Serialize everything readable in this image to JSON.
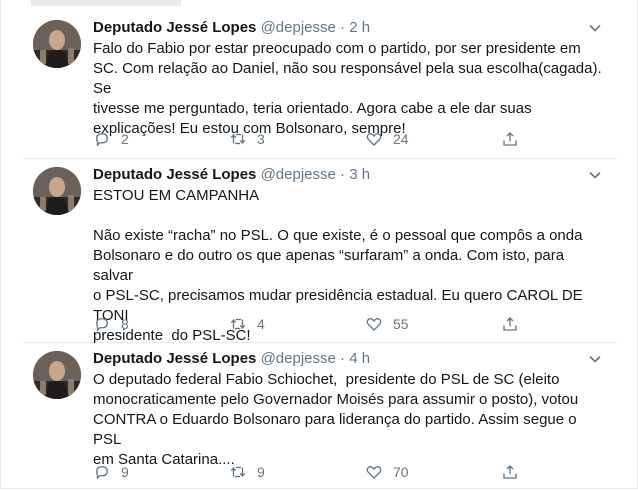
{
  "tweets": [
    {
      "name": "Deputado Jessé Lopes",
      "handle": "@depjesse",
      "separator": "·",
      "time": "2 h",
      "text": "Falo do Fabio por estar preocupado com o partido, por ser presidente em\nSC. Com relação ao Daniel, não sou responsável pela sua escolha(cagada). Se\ntivesse me perguntado, teria orientado. Agora cabe a ele dar suas\nexplicações! Eu estou com Bolsonaro, sempre!",
      "replies": "2",
      "retweets": "3",
      "likes": "24"
    },
    {
      "name": "Deputado Jessé Lopes",
      "handle": "@depjesse",
      "separator": "·",
      "time": "3 h",
      "text": "ESTOU EM CAMPANHA\n\nNão existe “racha” no PSL. O que existe, é o pessoal que compôs a onda\nBolsonaro e do outro os que apenas “surfaram” a onda. Com isto, para salvar\no PSL-SC, precisamos mudar presidência estadual. Eu quero CAROL DE TONI\npresidente  do PSL-SC!",
      "replies": "8",
      "retweets": "4",
      "likes": "55"
    },
    {
      "name": "Deputado Jessé Lopes",
      "handle": "@depjesse",
      "separator": "·",
      "time": "4 h",
      "text": "O deputado federal Fabio Schiochet,  presidente do PSL de SC (eleito\nmonocraticamente pelo Governador Moisés para assumir o posto), votou\nCONTRA o Eduardo Bolsonaro para liderança do partido. Assim segue o PSL\nem Santa Catarina....",
      "replies": "9",
      "retweets": "9",
      "likes": "70"
    }
  ],
  "icons": {
    "reply": "reply-icon",
    "retweet": "retweet-icon",
    "like": "heart-icon",
    "share": "share-icon",
    "more": "chevron-down-icon"
  },
  "colors": {
    "name": "#14171a",
    "muted": "#657786",
    "divider": "#e6ecf0"
  }
}
